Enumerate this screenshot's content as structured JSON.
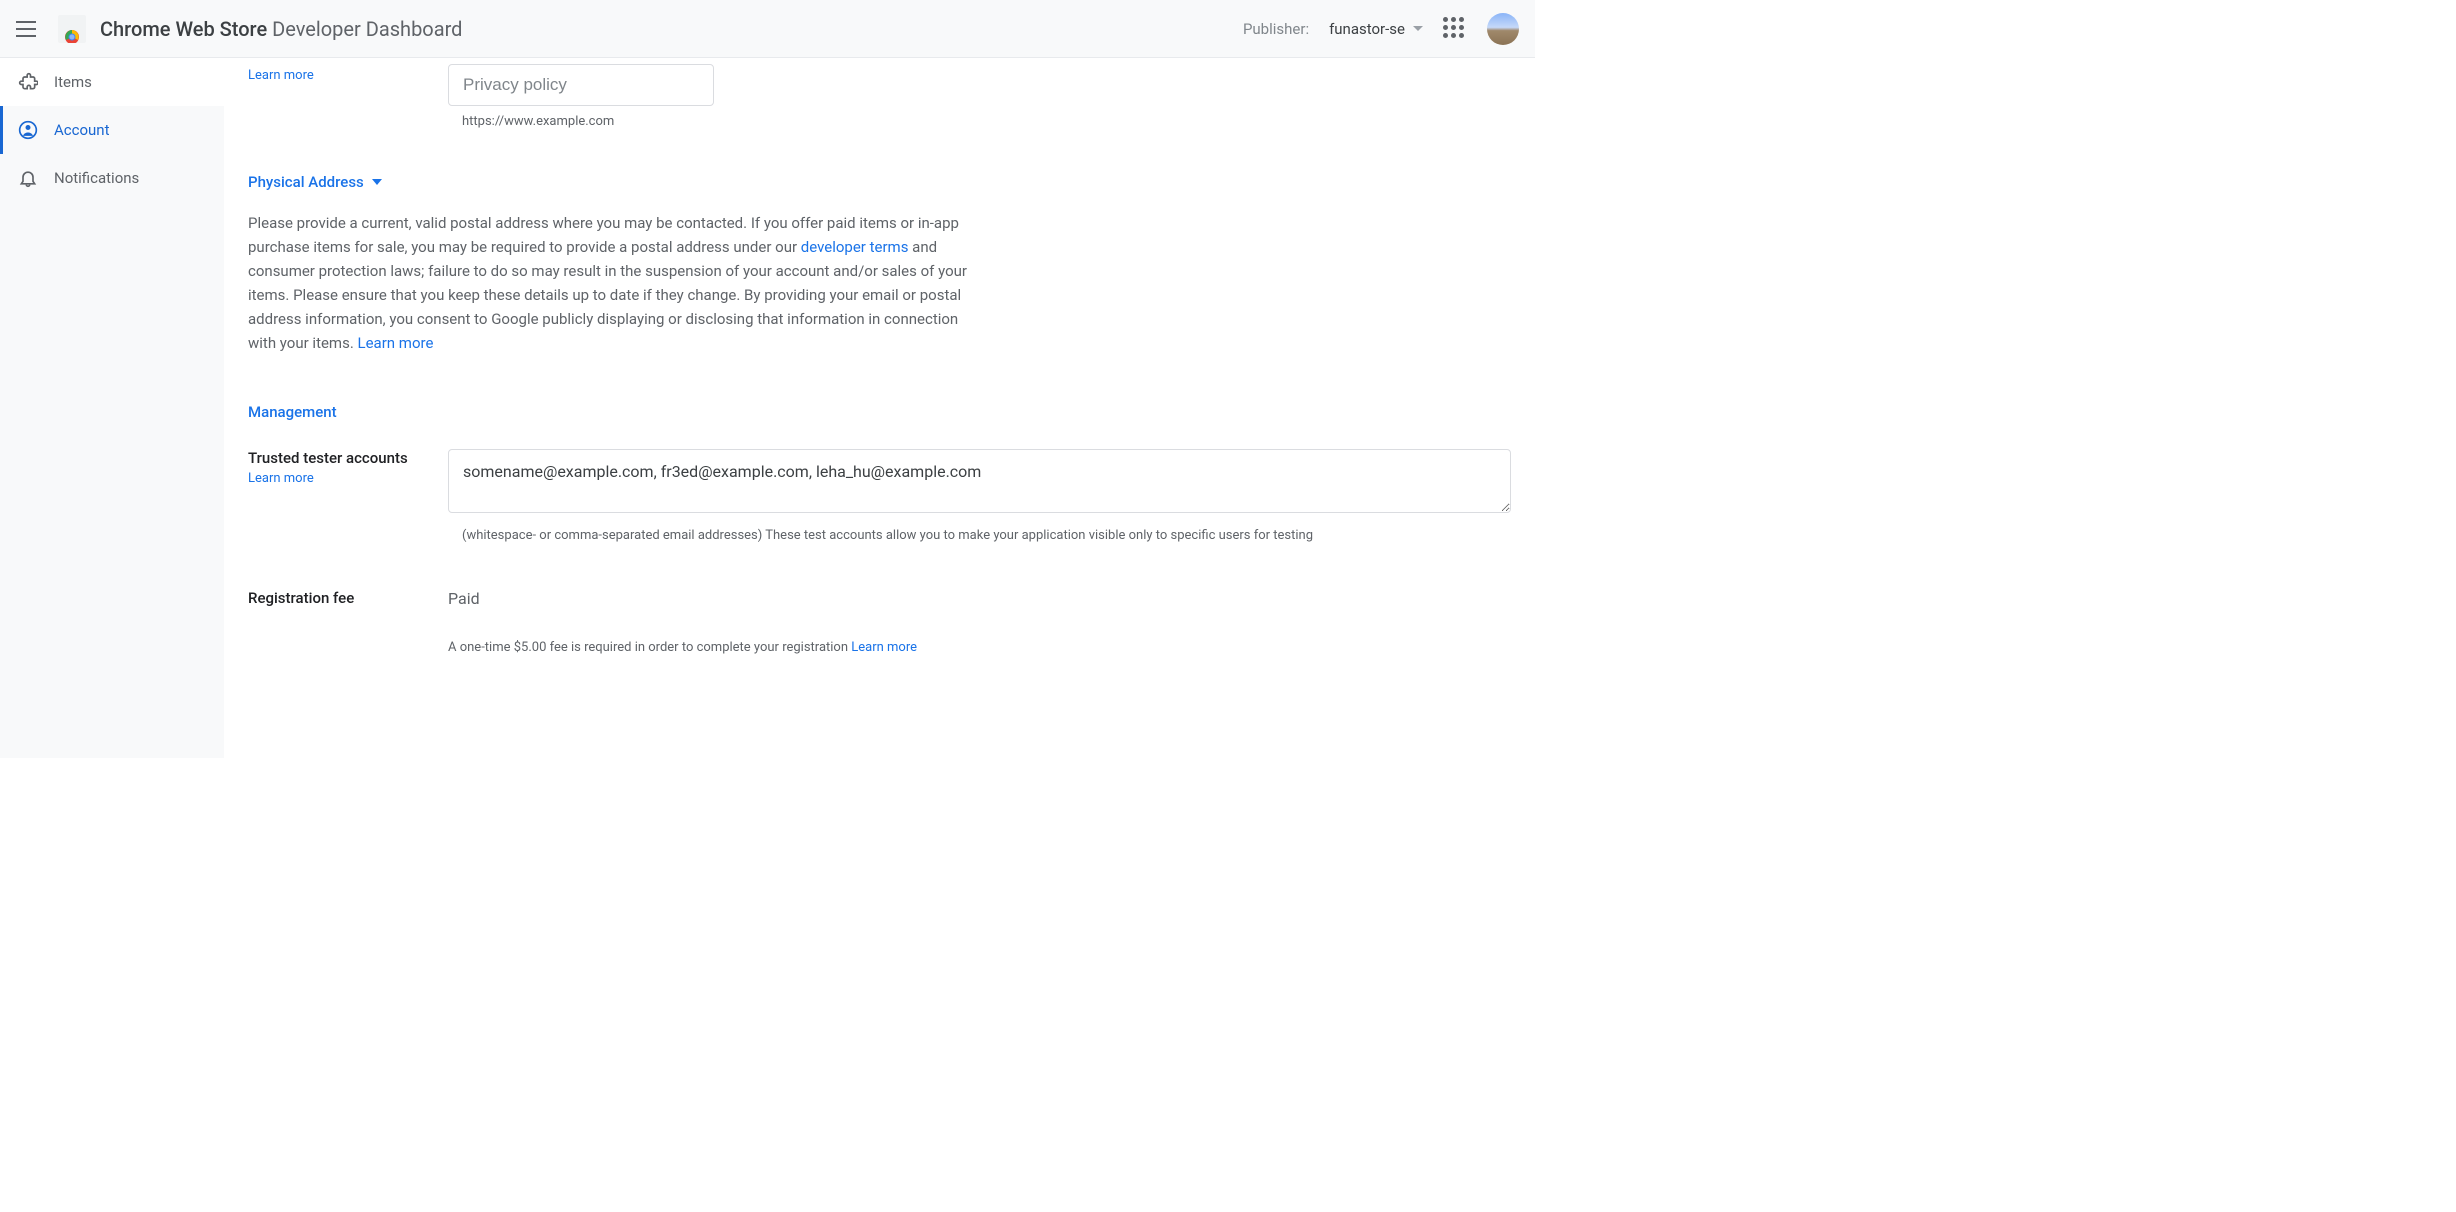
{
  "header": {
    "title_bold": "Chrome Web Store",
    "title_light": " Developer Dashboard",
    "publisher_label": "Publisher:",
    "publisher_value": "funastor-se"
  },
  "sidebar": {
    "items": [
      {
        "label": "Items"
      },
      {
        "label": "Account"
      },
      {
        "label": "Notifications"
      }
    ]
  },
  "privacy": {
    "learn_more": "Learn more",
    "placeholder": "Privacy policy",
    "helper": "https://www.example.com"
  },
  "physical_address": {
    "title": "Physical Address",
    "body_pre": "Please provide a current, valid postal address where you may be contacted. If you offer paid items or in-app purchase items for sale, you may be required to provide a postal address under our ",
    "link1": "developer terms",
    "body_mid": " and consumer protection laws; failure to do so may result in the suspension of your account and/or sales of your items. Please ensure that you keep these details up to date if they change. By providing your email or postal address information, you consent to Google publicly displaying or disclosing that information in connection with your items. ",
    "link2": "Learn more"
  },
  "management": {
    "title": "Management",
    "trusted_label": "Trusted tester accounts",
    "trusted_learn": "Learn more",
    "trusted_value": "somename@example.com, fr3ed@example.com, leha_hu@example.com",
    "trusted_helper": "(whitespace- or comma-separated email addresses) These test accounts allow you to make your application visible only to specific users for testing",
    "reg_label": "Registration fee",
    "reg_value": "Paid",
    "reg_helper": "A one-time $5.00 fee is required in order to complete your registration ",
    "reg_learn": "Learn more"
  }
}
